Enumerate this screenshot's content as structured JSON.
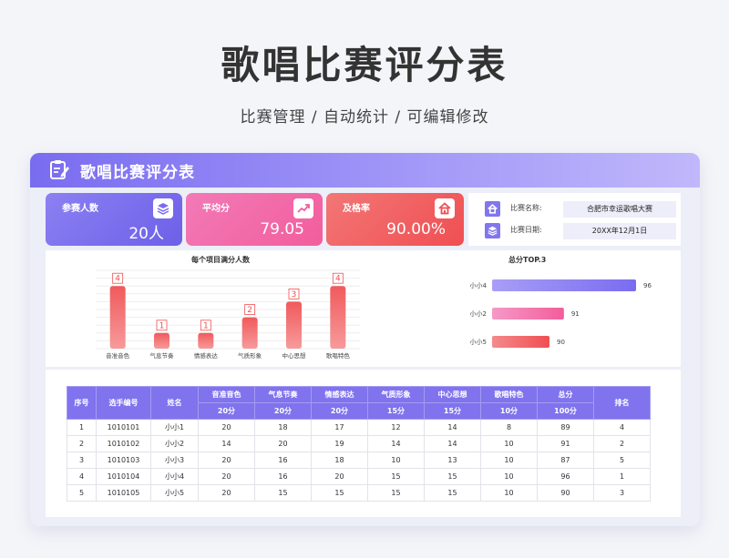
{
  "page": {
    "title": "歌唱比赛评分表",
    "subtitle": "比赛管理 / 自动统计 / 可编辑修改"
  },
  "header": {
    "title": "歌唱比赛评分表",
    "icon": "clipboard-edit-icon"
  },
  "stats": [
    {
      "label": "参赛人数",
      "value": "20人",
      "icon": "layers-icon",
      "color": "#7a6cf0"
    },
    {
      "label": "平均分",
      "value": "79.05",
      "icon": "trend-up-icon",
      "color": "#f35d9c"
    },
    {
      "label": "及格率",
      "value": "90.00%",
      "icon": "home-icon",
      "color": "#ef4f52"
    }
  ],
  "info": {
    "name_label": "比赛名称:",
    "name_value": "合肥市幸运歌唱大赛",
    "date_label": "比赛日期:",
    "date_value": "20XX年12月1日"
  },
  "chart_data": [
    {
      "type": "bar",
      "title": "每个项目满分人数",
      "categories": [
        "音准音色",
        "气息节奏",
        "情感表达",
        "气质形象",
        "中心思想",
        "歌唱特色"
      ],
      "values": [
        4,
        1,
        1,
        2,
        3,
        4
      ],
      "ylim": [
        0,
        5
      ],
      "grid": true,
      "color": "#ef4f52"
    },
    {
      "type": "bar",
      "orientation": "horizontal",
      "title": "总分TOP.3",
      "categories": [
        "小小4",
        "小小2",
        "小小5"
      ],
      "values": [
        96,
        91,
        90
      ],
      "colors": [
        "#7a6cf0",
        "#f35d9c",
        "#ef4f52"
      ]
    }
  ],
  "table": {
    "headers": {
      "no": "序号",
      "id": "选手编号",
      "name": "姓名",
      "items": [
        "音准音色",
        "气息节奏",
        "情感表达",
        "气质形象",
        "中心思想",
        "歌唱特色",
        "总分"
      ],
      "maxes": [
        "20分",
        "20分",
        "20分",
        "15分",
        "15分",
        "10分",
        "100分"
      ],
      "rank": "排名"
    },
    "rows": [
      [
        "1",
        "1010101",
        "小小1",
        "20",
        "18",
        "17",
        "12",
        "14",
        "8",
        "89",
        "4"
      ],
      [
        "2",
        "1010102",
        "小小2",
        "14",
        "20",
        "19",
        "14",
        "14",
        "10",
        "91",
        "2"
      ],
      [
        "3",
        "1010103",
        "小小3",
        "20",
        "16",
        "18",
        "10",
        "13",
        "10",
        "87",
        "5"
      ],
      [
        "4",
        "1010104",
        "小小4",
        "20",
        "16",
        "20",
        "15",
        "15",
        "10",
        "96",
        "1"
      ],
      [
        "5",
        "1010105",
        "小小5",
        "20",
        "15",
        "15",
        "15",
        "15",
        "10",
        "90",
        "3"
      ]
    ]
  }
}
